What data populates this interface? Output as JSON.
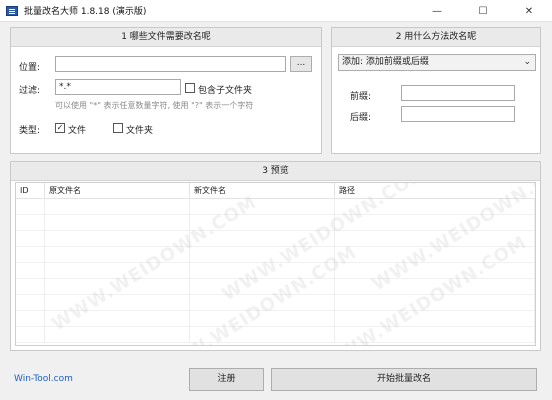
{
  "window": {
    "title": "批量改名大师 1.8.18 (演示版)",
    "minimize_glyph": "—",
    "maximize_glyph": "☐",
    "close_glyph": "✕"
  },
  "section1": {
    "header": "1 哪些文件需要改名呢",
    "location_label": "位置:",
    "location_value": "",
    "browse_label": "...",
    "filter_label": "过滤:",
    "filter_value": "*.*",
    "include_subfolders_label": "包含子文件夹",
    "include_subfolders_checked": false,
    "hint": "可以使用 \"*\" 表示任意数量字符, 使用 \"?\" 表示一个字符",
    "type_label": "类型:",
    "type_file_label": "文件",
    "type_file_checked": true,
    "type_folder_label": "文件夹",
    "type_folder_checked": false
  },
  "section2": {
    "header": "2 用什么方法改名呢",
    "method_selected": "添加: 添加前缀或后缀",
    "prefix_label": "前缀:",
    "prefix_value": "",
    "suffix_label": "后缀:",
    "suffix_value": ""
  },
  "section3": {
    "header": "3 预览",
    "columns": [
      "ID",
      "原文件名",
      "新文件名",
      "路径"
    ],
    "rows": []
  },
  "footer": {
    "link_text": "Win-Tool.com",
    "register_label": "注册",
    "start_label": "开始批量改名"
  },
  "watermark_text": "WWW.WEIDOWN.COM",
  "icons": {
    "app": "app-icon",
    "dropdown": "chevron-down-icon",
    "check": "checkmark-icon"
  }
}
